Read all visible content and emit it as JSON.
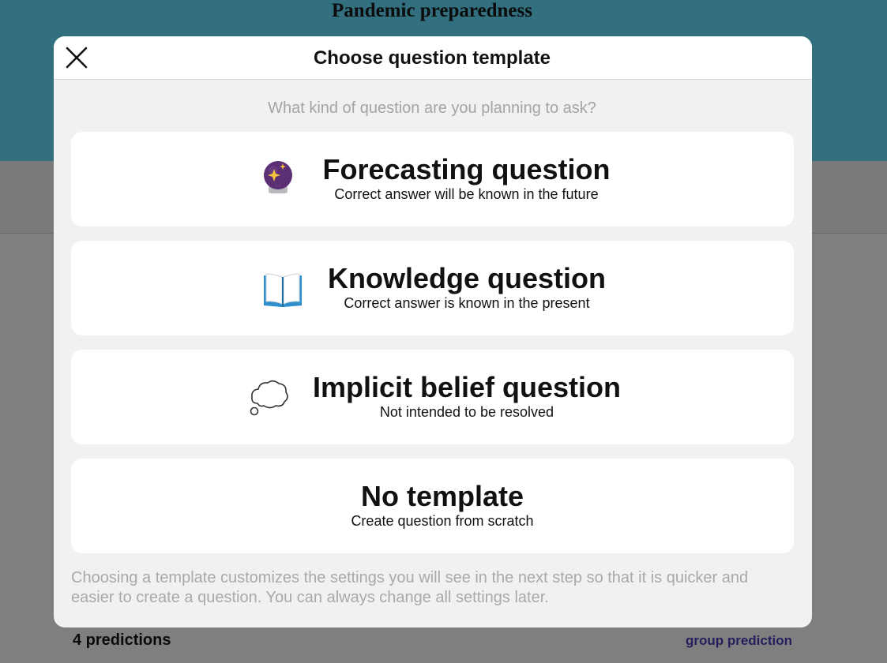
{
  "background": {
    "page_title": "Pandemic preparedness",
    "predictions_count": "4 predictions",
    "group_prediction_link": "group prediction"
  },
  "modal": {
    "title": "Choose question template",
    "prompt": "What kind of question are you planning to ask?",
    "options": [
      {
        "title": "Forecasting question",
        "subtitle": "Correct answer will be known in the future",
        "icon": "crystal-ball-icon"
      },
      {
        "title": "Knowledge question",
        "subtitle": "Correct answer is known in the present",
        "icon": "open-book-icon"
      },
      {
        "title": "Implicit belief question",
        "subtitle": "Not intended to be resolved",
        "icon": "thought-bubble-icon"
      },
      {
        "title": "No template",
        "subtitle": "Create question from scratch"
      }
    ],
    "footnote": "Choosing a template customizes the settings you will see in the next step so that it is quicker and easier to create a question. You can always change all settings later."
  },
  "colors": {
    "header_teal": "#326f7f",
    "overlay_gray": "#7f7f7f",
    "modal_bg": "#f1f1f1",
    "link_purple": "#241f5c"
  }
}
